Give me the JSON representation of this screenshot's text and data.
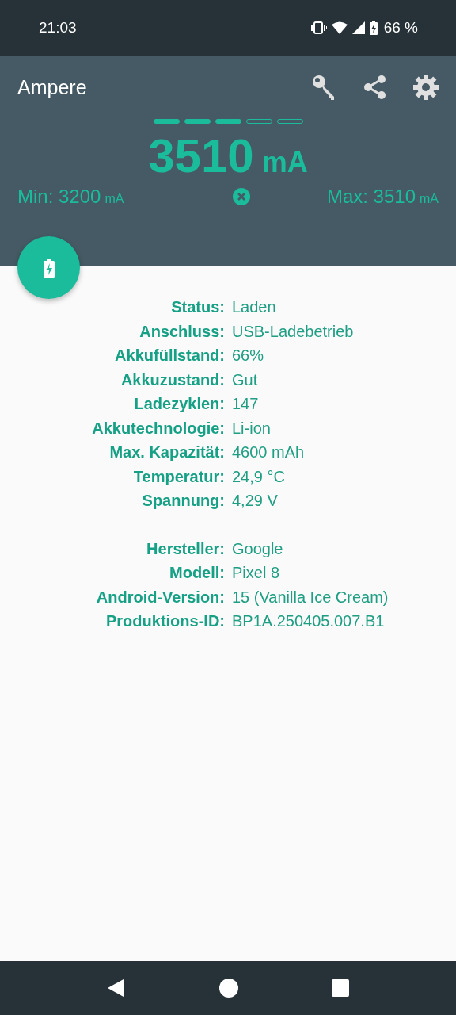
{
  "status_bar": {
    "time": "21:03",
    "battery": "66 %"
  },
  "app_bar": {
    "title": "Ampere"
  },
  "meter": {
    "segments": [
      {
        "filled": true
      },
      {
        "filled": true
      },
      {
        "filled": true
      },
      {
        "filled": false
      },
      {
        "filled": false
      }
    ],
    "current": "3510",
    "unit": "mA",
    "min": {
      "text": "Min: 3200",
      "unit": "mA"
    },
    "max": {
      "text": "Max: 3510",
      "unit": "mA"
    }
  },
  "info_groups": [
    {
      "rows": [
        {
          "label": "Status:",
          "value": "Laden"
        },
        {
          "label": "Anschluss:",
          "value": "USB-Ladebetrieb"
        },
        {
          "label": "Akkufüllstand:",
          "value": "66%"
        },
        {
          "label": "Akkuzustand:",
          "value": "Gut"
        },
        {
          "label": "Ladezyklen:",
          "value": "147"
        },
        {
          "label": "Akkutechnologie:",
          "value": "Li-ion"
        },
        {
          "label": "Max. Kapazität:",
          "value": "4600 mAh"
        },
        {
          "label": "Temperatur:",
          "value": "24,9 °C"
        },
        {
          "label": "Spannung:",
          "value": "4,29 V"
        }
      ]
    },
    {
      "rows": [
        {
          "label": "Hersteller:",
          "value": "Google"
        },
        {
          "label": "Modell:",
          "value": "Pixel 8"
        },
        {
          "label": "Android-Version:",
          "value": "15 (Vanilla Ice Cream)"
        },
        {
          "label": "Produktions-ID:",
          "value": "BP1A.250405.007.B1"
        }
      ]
    }
  ]
}
